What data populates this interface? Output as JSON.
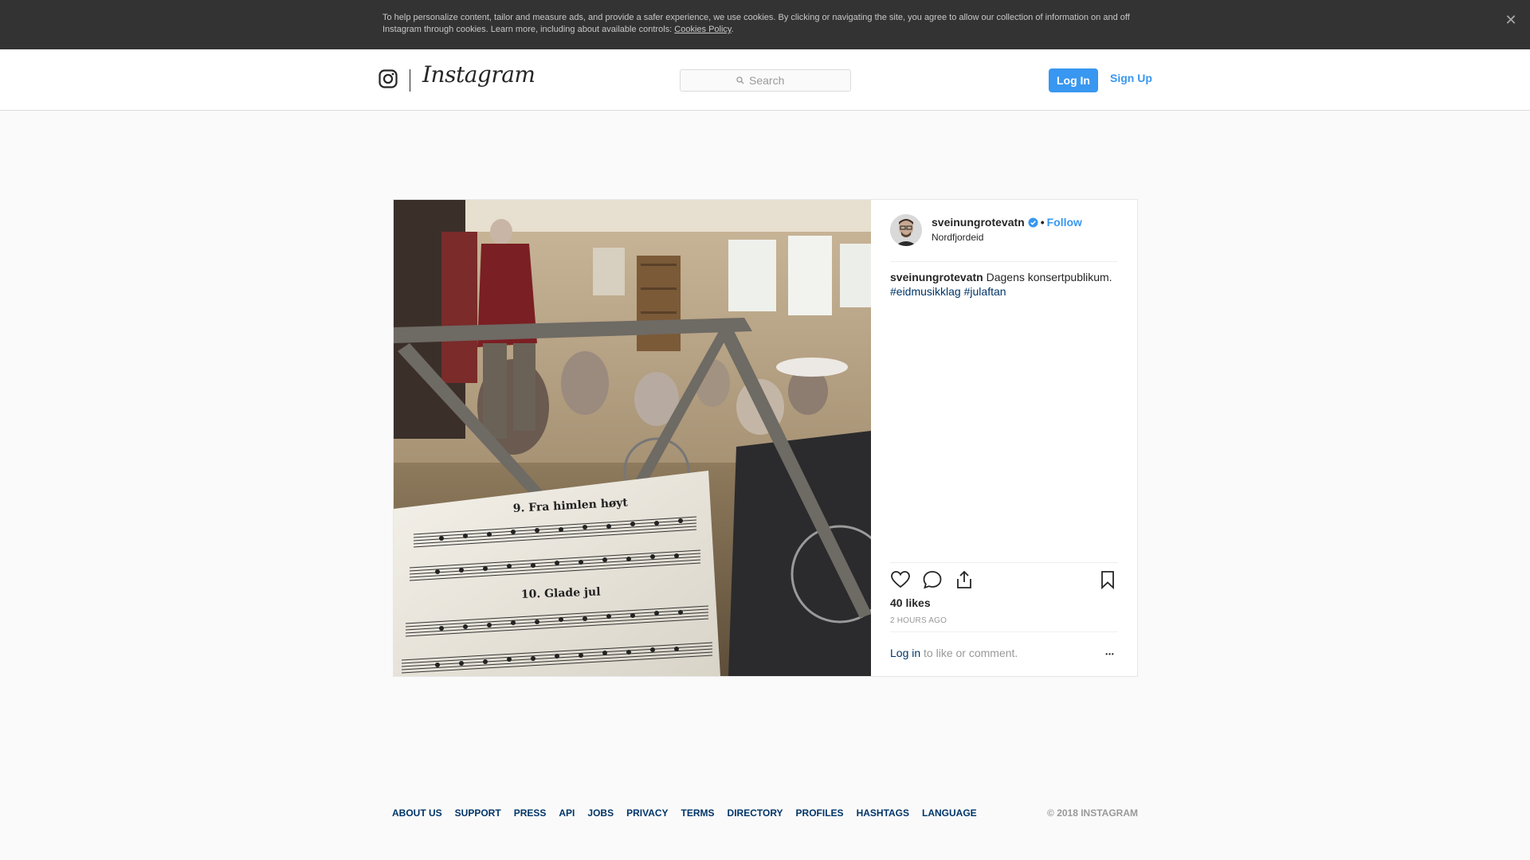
{
  "cookie_banner": {
    "text": "To help personalize content, tailor and measure ads, and provide a safer experience, we use cookies. By clicking or navigating the site, you agree to allow our collection of information on and off Instagram through cookies. Learn more, including about available controls:",
    "link": "Cookies Policy",
    "trailing": ".",
    "close_glyph": "✕"
  },
  "header": {
    "wordmark": "Instagram",
    "search_placeholder": "Search",
    "login_label": "Log In",
    "signup_label": "Sign Up"
  },
  "post": {
    "username": "sveinungrotevatn",
    "verified": true,
    "separator": "•",
    "follow_label": "Follow",
    "location": "Nordfjordeid",
    "caption_user": "sveinungrotevatn",
    "caption_text": "Dagens konsertpublikum.",
    "hashtags": [
      "#eidmusikklag",
      "#julaftan"
    ],
    "likes": "40 likes",
    "time": "2 HOURS AGO",
    "login_link": "Log in",
    "login_suffix": "to like or comment.",
    "more_glyph": "•••",
    "image": {
      "sheet_music": {
        "item_9": "9.   Fra himlen høyt",
        "item_10": "10.   Glade jul"
      }
    }
  },
  "footer": {
    "links": [
      "ABOUT US",
      "SUPPORT",
      "PRESS",
      "API",
      "JOBS",
      "PRIVACY",
      "TERMS",
      "DIRECTORY",
      "PROFILES",
      "HASHTAGS",
      "LANGUAGE"
    ],
    "copyright": "© 2018 INSTAGRAM"
  },
  "colors": {
    "accent": "#3897f0",
    "link_dark": "#003569",
    "banner_bg": "#333333"
  }
}
